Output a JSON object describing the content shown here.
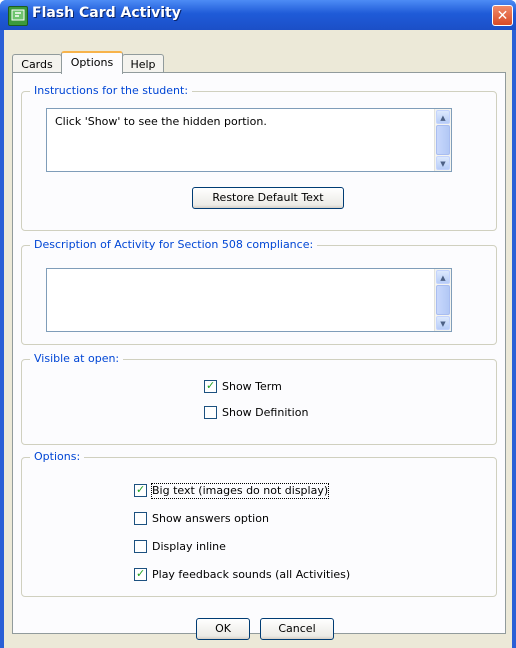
{
  "window": {
    "title": "Flash Card Activity",
    "close_glyph": "✕"
  },
  "tabs": [
    {
      "label": "Cards",
      "active": false
    },
    {
      "label": "Options",
      "active": true
    },
    {
      "label": "Help",
      "active": false
    }
  ],
  "instructions": {
    "legend": "Instructions for the student:",
    "value": "Click 'Show' to see the hidden portion.",
    "restore_label": "Restore Default Text"
  },
  "description": {
    "legend": "Description of Activity for Section 508 compliance:",
    "value": ""
  },
  "visible": {
    "legend": "Visible at open:",
    "items": [
      {
        "label": "Show Term",
        "checked": true
      },
      {
        "label": "Show Definition",
        "checked": false
      }
    ]
  },
  "options": {
    "legend": "Options:",
    "items": [
      {
        "label": "Big text (images do not display)",
        "checked": true
      },
      {
        "label": "Show answers option",
        "checked": false
      },
      {
        "label": "Display inline",
        "checked": false
      },
      {
        "label": "Play feedback sounds (all Activities)",
        "checked": true
      }
    ]
  },
  "footer": {
    "ok_label": "OK",
    "cancel_label": "Cancel"
  },
  "colors": {
    "titlebar": "#1f5bd8",
    "dialog_bg": "#ece9d8",
    "legend": "#0046d5",
    "check": "#21a121"
  }
}
